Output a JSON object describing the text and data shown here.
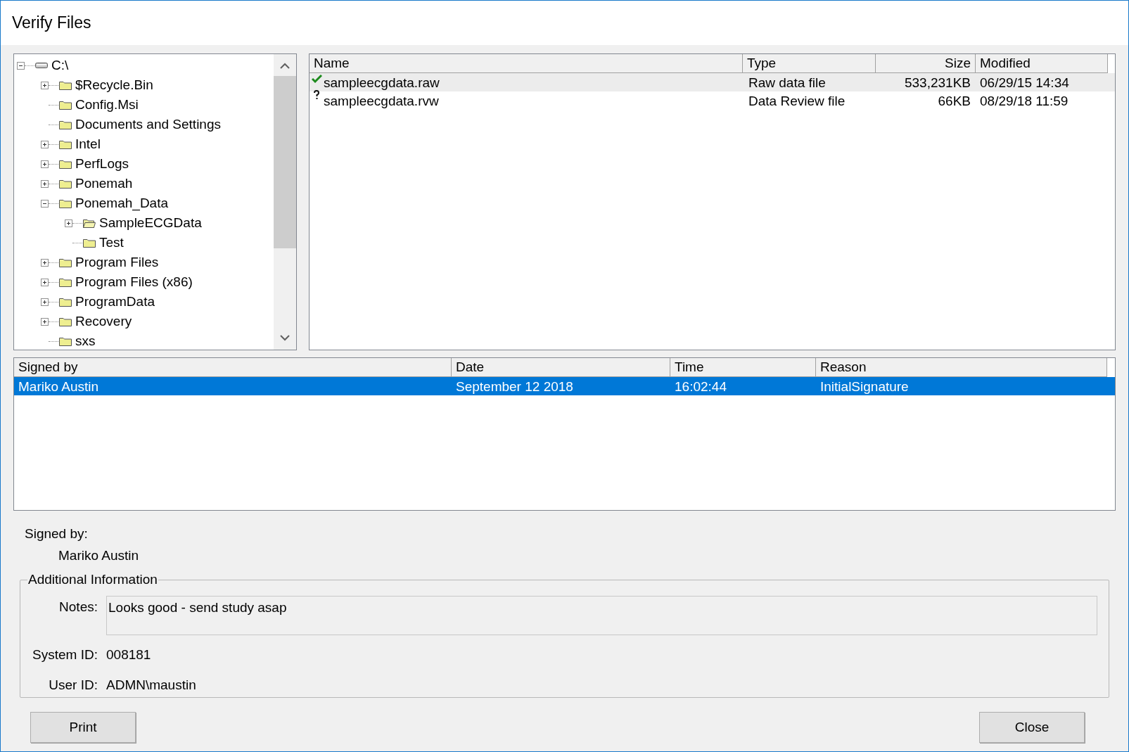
{
  "window": {
    "title": "Verify Files"
  },
  "tree": [
    {
      "label": "C:\\",
      "kind": "drive",
      "expanded": true,
      "children": [
        {
          "label": "$Recycle.Bin",
          "kind": "folder",
          "expanded": false
        },
        {
          "label": "Config.Msi",
          "kind": "folder"
        },
        {
          "label": "Documents and Settings",
          "kind": "folder"
        },
        {
          "label": "Intel",
          "kind": "folder",
          "expanded": false
        },
        {
          "label": "PerfLogs",
          "kind": "folder",
          "expanded": false
        },
        {
          "label": "Ponemah",
          "kind": "folder",
          "expanded": false
        },
        {
          "label": "Ponemah_Data",
          "kind": "folder",
          "expanded": true,
          "children": [
            {
              "label": "SampleECGData",
              "kind": "shared",
              "expanded": false
            },
            {
              "label": "Test",
              "kind": "folder"
            }
          ]
        },
        {
          "label": "Program Files",
          "kind": "folder",
          "expanded": false
        },
        {
          "label": "Program Files (x86)",
          "kind": "folder",
          "expanded": false
        },
        {
          "label": "ProgramData",
          "kind": "folder",
          "expanded": false
        },
        {
          "label": "Recovery",
          "kind": "folder",
          "expanded": false
        },
        {
          "label": "sxs",
          "kind": "folder"
        }
      ]
    }
  ],
  "files": {
    "columns": [
      "Name",
      "Type",
      "Size",
      "Modified"
    ],
    "rows": [
      {
        "verified": true,
        "name": "sampleecgdata.raw",
        "type": "Raw data file",
        "size": "533,231KB",
        "modified": "06/29/15 14:34",
        "selected": true
      },
      {
        "verified": false,
        "name": "sampleecgdata.rvw",
        "type": "Data Review file",
        "size": "66KB",
        "modified": "08/29/18 11:59",
        "selected": false
      }
    ]
  },
  "signatures": {
    "columns": [
      "Signed by",
      "Date",
      "Time",
      "Reason"
    ],
    "rows": [
      {
        "signed_by": "Mariko Austin",
        "date": "September 12 2018",
        "time": "16:02:44",
        "reason": "InitialSignature",
        "selected": true
      }
    ]
  },
  "signed_by": {
    "label": "Signed by:",
    "value": "Mariko Austin"
  },
  "additional_information": {
    "title": "Additional Information",
    "notes_label": "Notes:",
    "notes": "Looks good - send study asap",
    "system_id_label": "System ID:",
    "system_id": "008181",
    "user_id_label": "User ID:",
    "user_id": "ADMN\\maustin"
  },
  "buttons": [
    {
      "label": "Print"
    },
    {
      "label": "Close"
    }
  ]
}
